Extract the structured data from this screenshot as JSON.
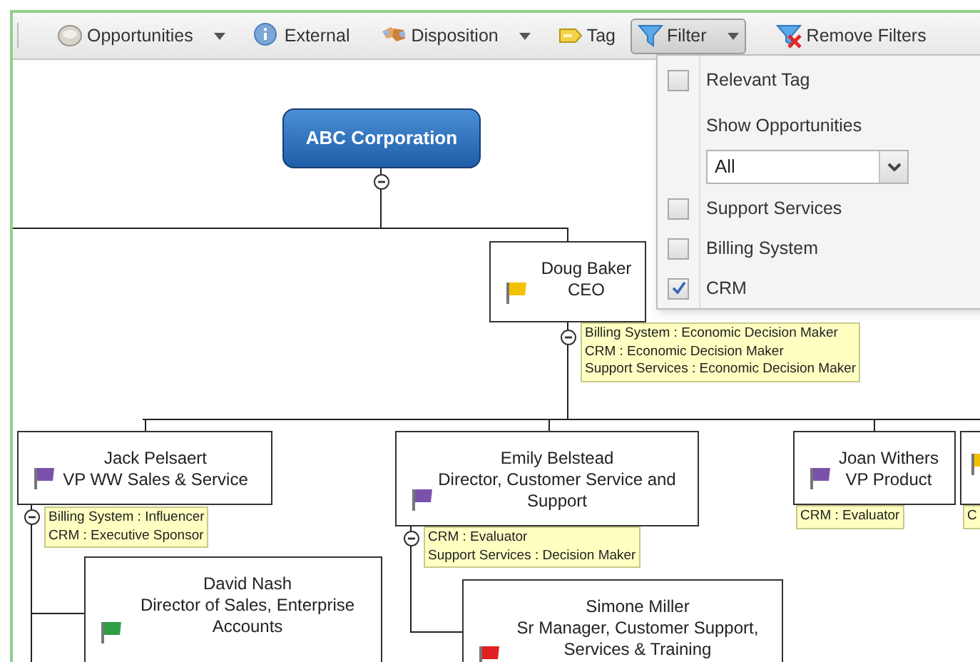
{
  "toolbar": {
    "items": [
      {
        "label": "Opportunities",
        "has_menu": true,
        "selected": false
      },
      {
        "label": "External",
        "has_menu": false,
        "selected": false
      },
      {
        "label": "Disposition",
        "has_menu": true,
        "selected": false
      },
      {
        "label": "Tag",
        "has_menu": false,
        "selected": false
      },
      {
        "label": "Filter",
        "has_menu": true,
        "selected": true
      },
      {
        "label": "Remove Filters",
        "has_menu": false,
        "selected": false
      }
    ]
  },
  "filter_menu": {
    "items": [
      {
        "kind": "checkbox",
        "label": "Relevant Tag",
        "checked": false
      },
      {
        "kind": "select",
        "label": "Show Opportunities",
        "value": "All"
      },
      {
        "kind": "checkbox",
        "label": "Support Services",
        "checked": false
      },
      {
        "kind": "checkbox",
        "label": "Billing System",
        "checked": false
      },
      {
        "kind": "checkbox",
        "label": "CRM",
        "checked": true
      }
    ]
  },
  "org_chart": {
    "root": {
      "name": "ABC Corporation",
      "expanded": true,
      "children": [
        {
          "name": "Doug Baker",
          "title": "CEO",
          "color": "#f2c200",
          "expanded": true,
          "roles": [
            "Billing System : Economic Decision Maker",
            "CRM : Economic Decision Maker",
            "Support Services : Economic Decision Maker"
          ],
          "children": [
            {
              "name": "Jack Pelsaert",
              "title": "VP WW Sales & Service",
              "color": "#7b52ab",
              "expanded": true,
              "roles": [
                "Billing System : Influencer",
                "CRM : Executive Sponsor"
              ],
              "children": [
                {
                  "name": "David Nash",
                  "title": "Director of  Sales, Enterprise Accounts",
                  "color": "#2ea043"
                }
              ]
            },
            {
              "name": "Emily Belstead",
              "title": "Director, Customer Service and Support",
              "color": "#7b52ab",
              "expanded": true,
              "roles": [
                "CRM : Evaluator",
                "Support Services : Decision Maker"
              ],
              "children": [
                {
                  "name": "Simone Miller",
                  "title": "Sr Manager, Customer Support, Services & Training",
                  "color": "#e02020"
                }
              ]
            },
            {
              "name": "Joan Withers",
              "title": "VP Product",
              "color": "#7b52ab",
              "roles": [
                "CRM : Evaluator"
              ]
            },
            {
              "color": "#f2c200",
              "roles": [
                "C"
              ]
            }
          ]
        }
      ]
    }
  }
}
